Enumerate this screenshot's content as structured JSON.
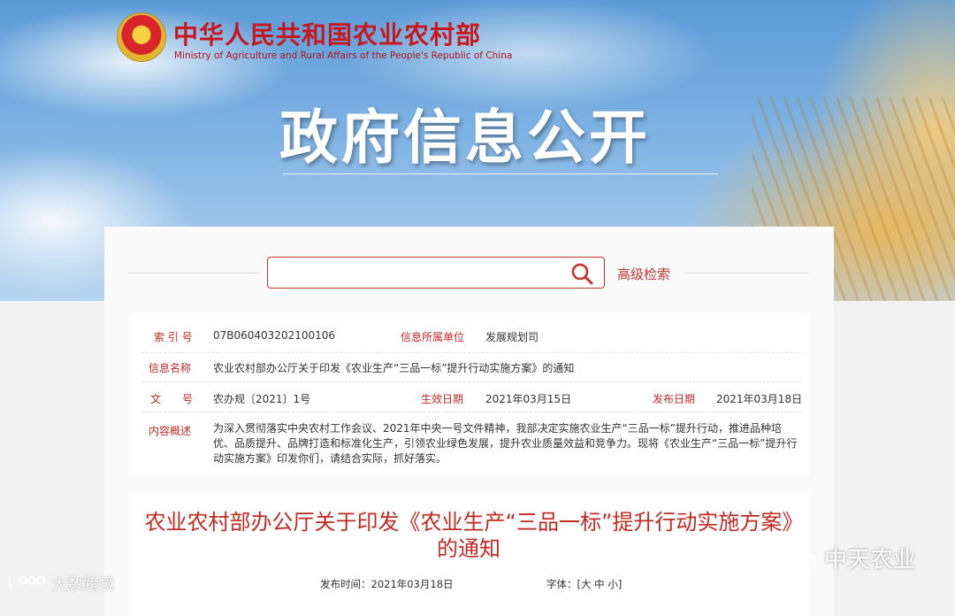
{
  "header": {
    "ministry_cn": "中华人民共和国农业农村部",
    "ministry_en": "Ministry of Agriculture and Rural Affairs of the People's Republic of China",
    "section_title": "政府信息公开"
  },
  "search": {
    "placeholder": "",
    "advanced_label": "高级检索"
  },
  "meta": {
    "index_label": "索 引 号",
    "index_value": "07B060403202100106",
    "unit_label": "信息所属单位",
    "unit_value": "发展规划司",
    "name_label": "信息名称",
    "name_value": "农业农村部办公厅关于印发《农业生产“三品一标”提升行动实施方案》的通知",
    "doc_label": "文　　号",
    "doc_value": "农办规〔2021〕1号",
    "effective_label": "生效日期",
    "effective_value": "2021年03月15日",
    "publish_label": "发布日期",
    "publish_value": "2021年03月18日",
    "summary_label": "内容概述",
    "summary_value": "为深入贯彻落实中央农村工作会议、2021年中央一号文件精神，我部决定实施农业生产“三品一标”提升行动，推进品种培优、品质提升、品牌打造和标准化生产，引领农业绿色发展，提升农业质量效益和竞争力。现将《农业生产“三品一标”提升行动实施方案》印发你们，请结合实际，抓好落实。"
  },
  "article": {
    "title": "农业农村部办公厅关于印发《农业生产“三品一标”提升行动实施方案》的通知",
    "pub_time": "发布时间：2021年03月18日",
    "font_label": "字体：",
    "font_open": "[",
    "font_large": "大",
    "font_medium": "中",
    "font_small": "小",
    "font_close": "]"
  },
  "watermarks": {
    "left_text": "大数跨境",
    "right_text": "中天农业"
  },
  "colors": {
    "accent": "#c12a22",
    "ministry_red": "#c9171e"
  },
  "icons": [
    "emblem-icon",
    "search-icon",
    "wechat-icon",
    "logo-icon"
  ]
}
